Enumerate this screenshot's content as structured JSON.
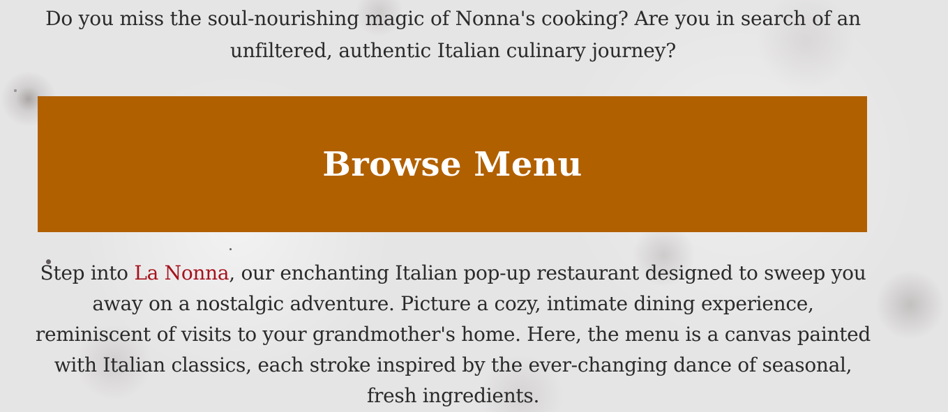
{
  "intro": {
    "text": "Do you miss the soul-nourishing magic of Nonna's cooking? Are you in search of an unfiltered, authentic Italian culinary journey?"
  },
  "cta": {
    "label": "Browse Menu",
    "background_color": "#b16000",
    "text_color": "#ffffff"
  },
  "about": {
    "prefix": "Step into ",
    "brand_name": "La Nonna",
    "brand_color": "#a5131c",
    "suffix": ", our enchanting Italian pop-up restaurant designed to sweep you away on a nostalgic adventure. Picture a cozy, intimate dining experience, reminiscent of visits to your grandmother's home. Here, the menu is a canvas painted with Italian classics, each stroke inspired by the ever-changing dance of seasonal, fresh ingredients."
  }
}
